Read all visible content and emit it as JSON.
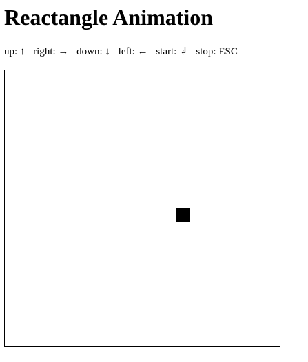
{
  "page": {
    "title": "Reactangle Animation"
  },
  "controls": {
    "up": "up: ↑",
    "right": "right: →",
    "down": "down: ↓",
    "left": "left: ←",
    "start": "start: ↲",
    "stop": "stop: ESC"
  },
  "canvas": {
    "background": "#ffffff",
    "border_color": "#000000",
    "rectangle_color": "#000000"
  }
}
